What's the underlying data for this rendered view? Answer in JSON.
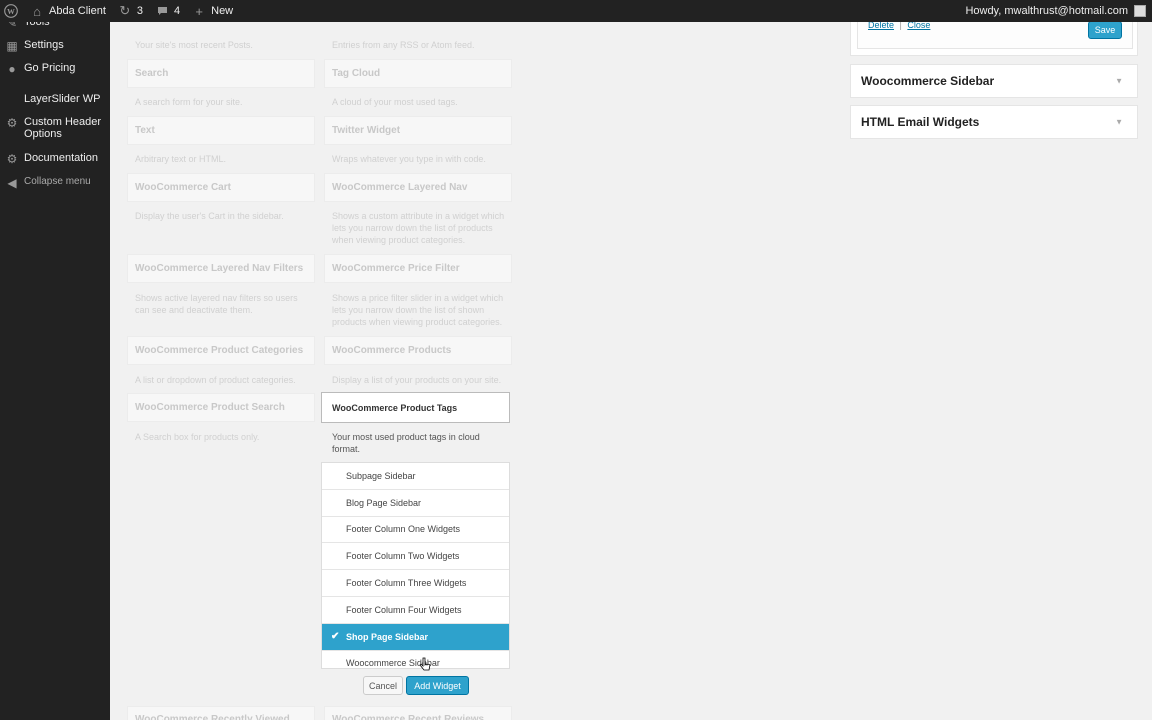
{
  "adminbar": {
    "site_name": "Abda Client",
    "updates_count": "3",
    "comments_count": "4",
    "new_label": "New",
    "howdy": "Howdy, mwalthrust@hotmail.com"
  },
  "menu": {
    "tools": "Tools",
    "settings": "Settings",
    "go_pricing": "Go Pricing",
    "layerslider": "LayerSlider WP",
    "custom_header": "Custom Header Options",
    "documentation": "Documentation",
    "collapse": "Collapse menu"
  },
  "widgets": {
    "top_left_desc": "Your site's most recent Posts.",
    "top_right_desc": "Entries from any RSS or Atom feed.",
    "search": {
      "title": "Search",
      "desc": "A search form for your site."
    },
    "tag_cloud": {
      "title": "Tag Cloud",
      "desc": "A cloud of your most used tags."
    },
    "text": {
      "title": "Text",
      "desc": "Arbitrary text or HTML."
    },
    "twitter": {
      "title": "Twitter Widget",
      "desc": "Wraps whatever you type in with code."
    },
    "wc_cart": {
      "title": "WooCommerce Cart",
      "desc": "Display the user's Cart in the sidebar."
    },
    "wc_layered_nav": {
      "title": "WooCommerce Layered Nav",
      "desc": "Shows a custom attribute in a widget which lets you narrow down the list of products when viewing product categories."
    },
    "wc_layered_filters": {
      "title": "WooCommerce Layered Nav Filters",
      "desc": "Shows active layered nav filters so users can see and deactivate them."
    },
    "wc_price_filter": {
      "title": "WooCommerce Price Filter",
      "desc": "Shows a price filter slider in a widget which lets you narrow down the list of shown products when viewing product categories."
    },
    "wc_product_categories": {
      "title": "WooCommerce Product Categories",
      "desc": "A list or dropdown of product categories."
    },
    "wc_products": {
      "title": "WooCommerce Products",
      "desc": "Display a list of your products on your site."
    },
    "wc_product_search": {
      "title": "WooCommerce Product Search",
      "desc": "A Search box for products only."
    },
    "wc_product_tags": {
      "title": "WooCommerce Product Tags",
      "desc": "Your most used product tags in cloud format."
    },
    "wc_recently_viewed": {
      "title": "WooCommerce Recently Viewed"
    },
    "wc_recent_reviews": {
      "title": "WooCommerce Recent Reviews"
    }
  },
  "chooser": {
    "options": [
      {
        "label": "Subpage Sidebar",
        "selected": false
      },
      {
        "label": "Blog Page Sidebar",
        "selected": false
      },
      {
        "label": "Footer Column One Widgets",
        "selected": false
      },
      {
        "label": "Footer Column Two Widgets",
        "selected": false
      },
      {
        "label": "Footer Column Three Widgets",
        "selected": false
      },
      {
        "label": "Footer Column Four Widgets",
        "selected": false
      },
      {
        "label": "Shop Page Sidebar",
        "selected": true
      },
      {
        "label": "Woocommerce Sidebar",
        "selected": false
      }
    ],
    "check_glyph": "✔",
    "cancel_label": "Cancel",
    "add_label": "Add Widget"
  },
  "right_panel": {
    "delete_label": "Delete",
    "separator": "|",
    "close_label": "Close",
    "save_label": "Save",
    "woocommerce_sidebar": "Woocommerce Sidebar",
    "html_email_widgets": "HTML Email Widgets"
  },
  "colors": {
    "accent": "#2ea2cc",
    "adminbar": "#222222",
    "link": "#0074a2"
  },
  "icons": {
    "wp_logo": "wordpress-icon",
    "home": "home-icon",
    "updates": "updates-icon",
    "comments": "comment-icon",
    "new": "plus-icon",
    "tools": "wrench-icon",
    "settings": "settings-icon",
    "go_pricing": "pricing-icon",
    "custom_header": "gear-icon",
    "documentation": "gear-icon",
    "collapse": "collapse-icon"
  }
}
